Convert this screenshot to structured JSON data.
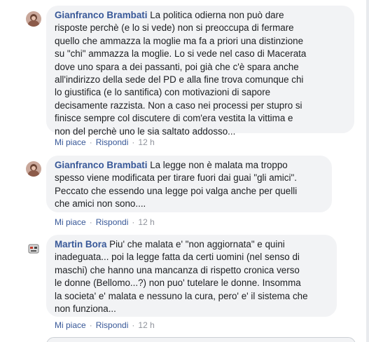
{
  "comments": [
    {
      "author": "Gianfranco Brambati",
      "first_line": "La politica odierna non può dare",
      "lines": [
        "risposte perchè (e lo si vede) non si preoccupa di fermare",
        "quello che ammazza la moglie ma fa a priori una distinzione",
        "su \"chi\" ammazza la moglie. Lo si vede nel caso di Macerata",
        "dove uno spara a dei passanti, poi già che c'è spara anche",
        "all'indirizzo della sede del PD e alla fine trova comunque chi",
        "lo giustifica (e lo santifica) con motivazioni di sapore",
        "decisamente razzista. Non a caso nei processi per stupro si",
        "finisce sempre col discutere di com'era vestita la vittima e",
        "non del perchè uno le sia saltato addosso..."
      ],
      "like_label": "Mi piace",
      "reply_label": "Rispondi",
      "separator": "·",
      "time": "12 h",
      "avatar": "avatar-photo-woman"
    },
    {
      "author": "Gianfranco Brambati",
      "first_line": "La legge non è malata ma troppo",
      "lines": [
        "spesso viene modificata per tirare fuori dai guai \"gli amici\".",
        "Peccato che essendo una legge poi valga anche per quelli",
        "che amici non sono...."
      ],
      "like_label": "Mi piace",
      "reply_label": "Rispondi",
      "separator": "·",
      "time": "12 h",
      "avatar": "avatar-photo-woman"
    },
    {
      "author": "Martin Bora",
      "first_line": "Piu' che malata e' \"non aggiornata\" e quini",
      "lines": [
        "inadeguata... poi la legge fatta da certi uomini (nel senso di",
        "maschi) che hanno una mancanza di rispetto cronica verso",
        "le donne (Bellomo...?) non puo' tutelare le donne. Insomma",
        "la societa' e' malata e nessuno la cura, pero' e' il sistema che",
        "non funziona..."
      ],
      "like_label": "Mi piace",
      "reply_label": "Rispondi",
      "separator": "·",
      "time": "12 h",
      "avatar": "avatar-photo-robot"
    }
  ],
  "colors": {
    "bubble": "#f2f3f5",
    "author": "#385898",
    "text": "#1c1e21",
    "meta": "#90949c"
  }
}
